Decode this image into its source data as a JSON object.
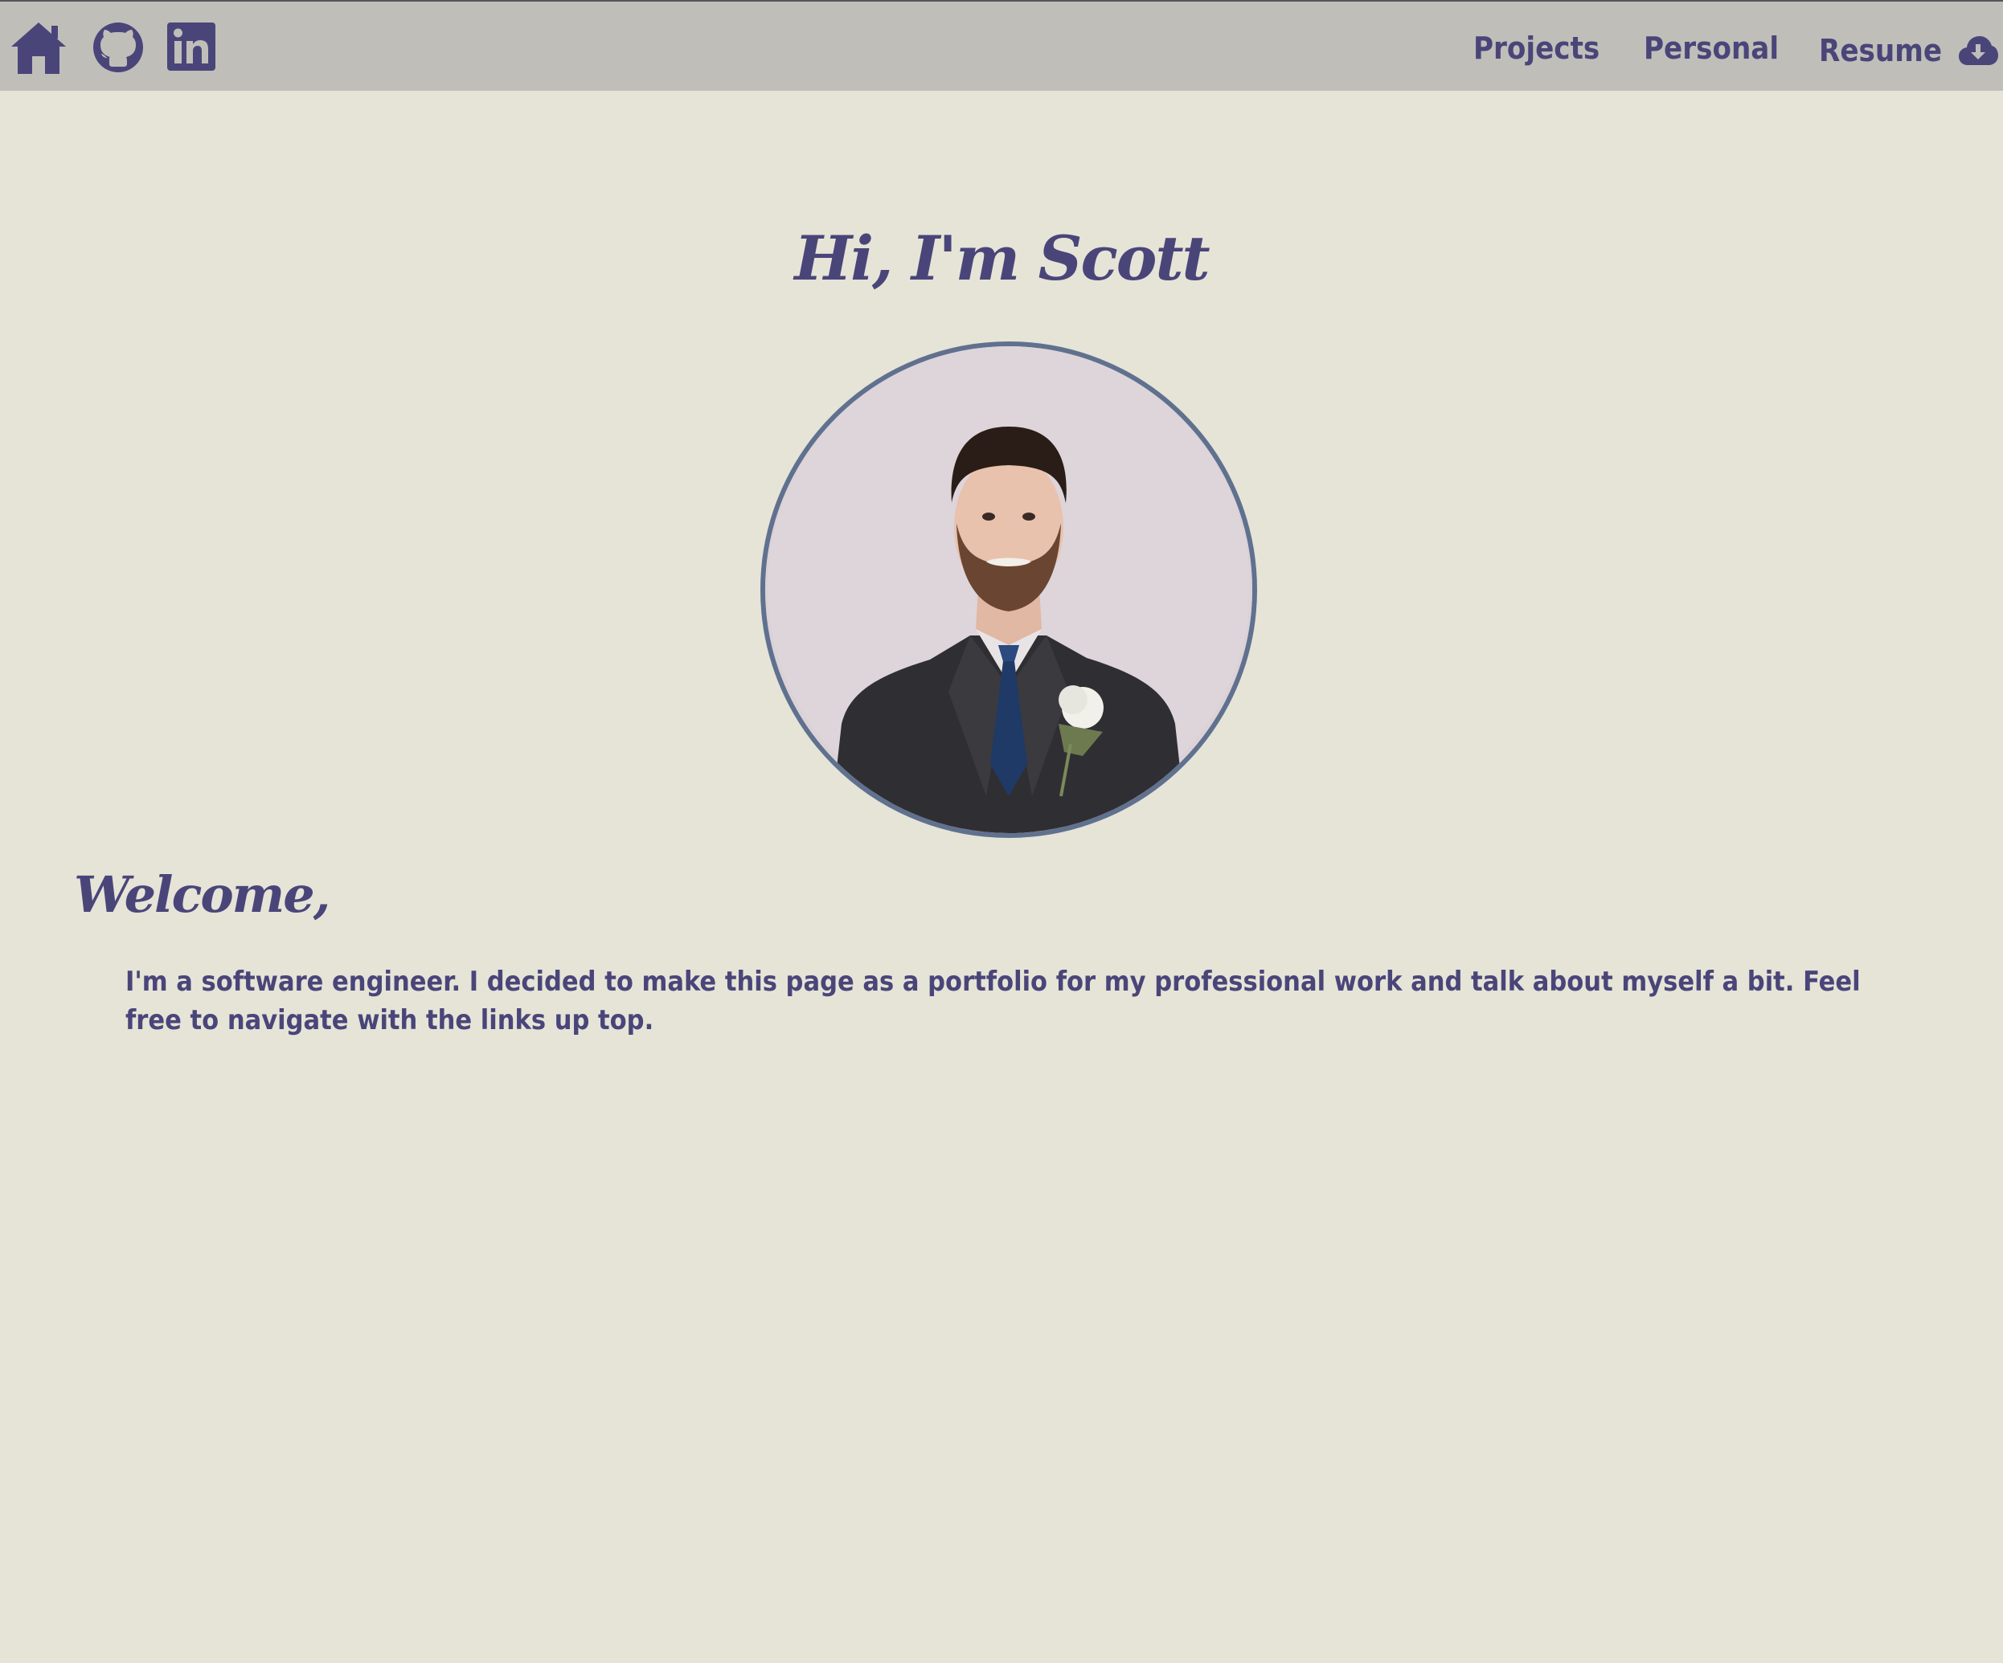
{
  "nav": {
    "icons": {
      "home": "home-icon",
      "github": "github-icon",
      "linkedin": "linkedin-icon",
      "resume_download": "cloud-download-icon"
    },
    "links": {
      "projects": "Projects",
      "personal": "Personal",
      "resume": "Resume"
    }
  },
  "hero": {
    "title": "Hi, I'm Scott"
  },
  "welcome": {
    "heading": "Welcome,",
    "body": "I'm a software engineer. I decided to make this page as a portfolio for my professional work and talk about myself a bit. Feel free to navigate with the links up top."
  },
  "colors": {
    "background": "#e5e4d7",
    "navbar": "#bfbeb9",
    "accent": "#4a4579",
    "avatar_border": "#60718f"
  }
}
